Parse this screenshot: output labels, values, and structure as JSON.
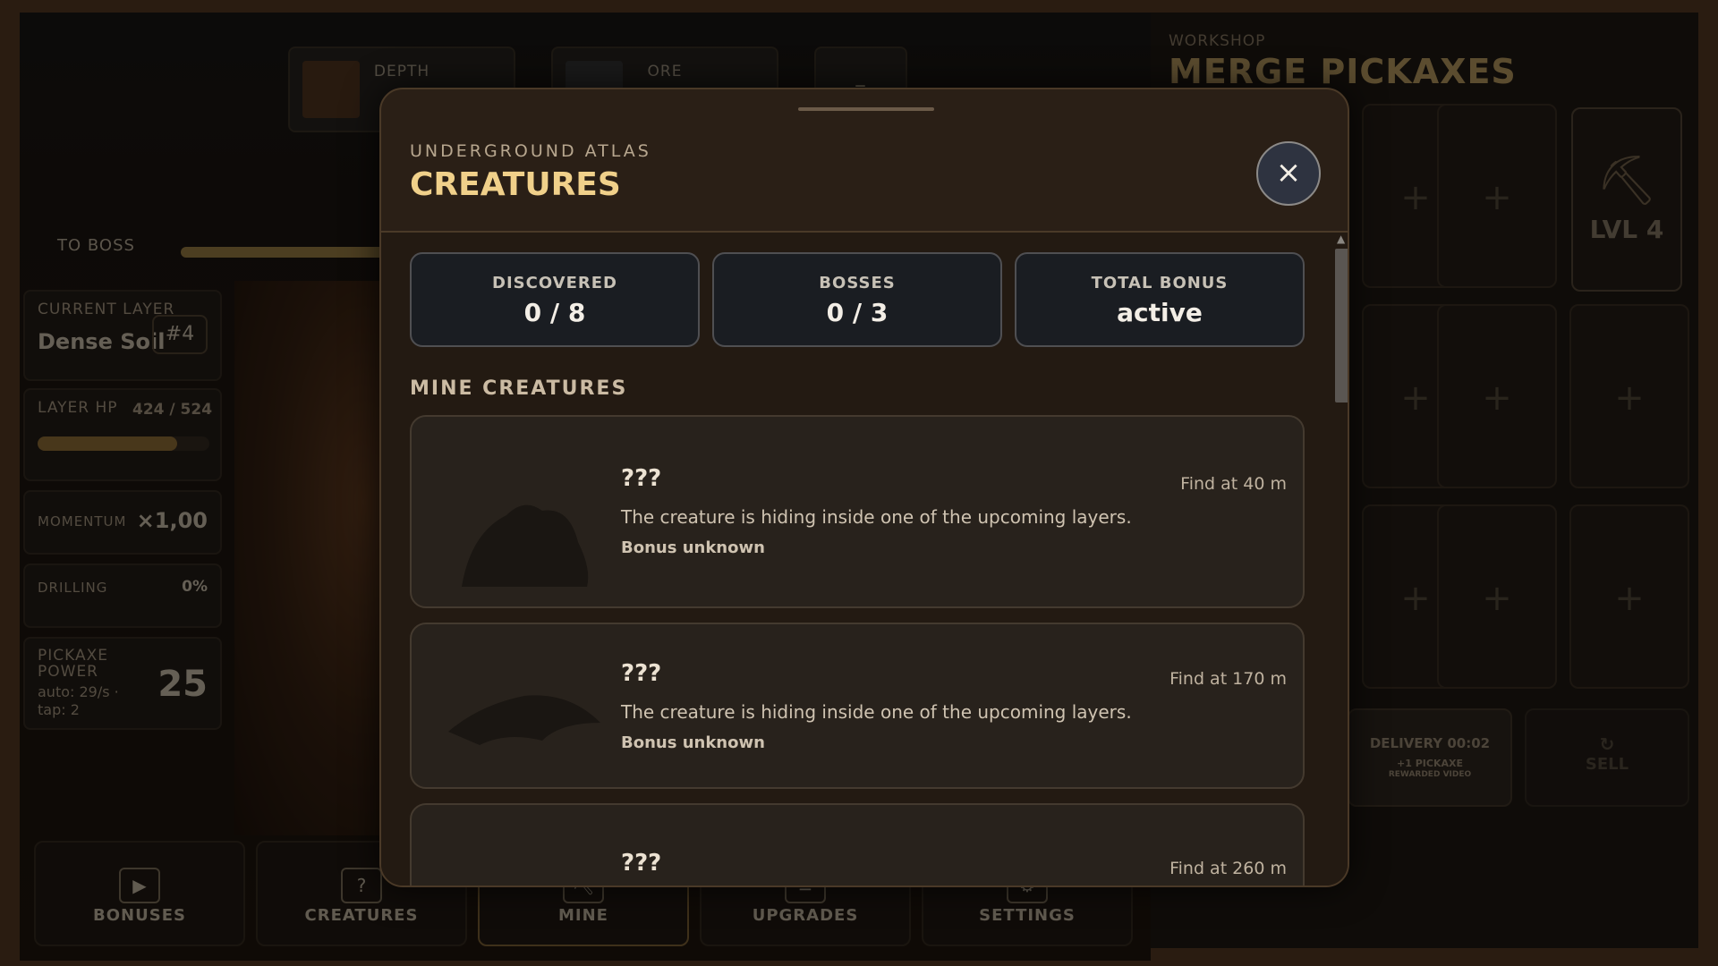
{
  "hud": {
    "depth_label": "DEPTH",
    "ore_label": "ORE",
    "small_label": "–",
    "to_boss_label": "TO BOSS",
    "boss_progress": 0.45
  },
  "stats_panel": {
    "current_layer_label": "CURRENT LAYER",
    "current_layer_value": "Dense Soil",
    "layer_number": "#4",
    "layer_hp_label": "LAYER HP",
    "layer_hp_value": "424 / 524",
    "layer_hp_fraction": 0.81,
    "momentum_label": "MOMENTUM",
    "momentum_value": "×1,00",
    "drilling_label": "DRILLING",
    "drilling_value": "0%",
    "pickaxe_power_label": "PICKAXE POWER",
    "pickaxe_power_sub": "auto: 29/s · tap: 2",
    "pickaxe_power_value": "25"
  },
  "bottom_nav": [
    {
      "label": "BONUSES",
      "icon": "▶"
    },
    {
      "label": "CREATURES",
      "icon": "?"
    },
    {
      "label": "MINE",
      "icon": "⛏"
    },
    {
      "label": "UPGRADES",
      "icon": "≡"
    },
    {
      "label": "SETTINGS",
      "icon": "⚙"
    }
  ],
  "workshop": {
    "subtitle": "WORKSHOP",
    "title": "MERGE PICKAXES",
    "slot_plus": "+",
    "filled_slot_level": "LVL 4",
    "delivery_label": "DELIVERY 00:02",
    "delivery_sub1": "+1 PICKAXE",
    "delivery_sub2": "REWARDED VIDEO",
    "sell_label": "SELL"
  },
  "modal": {
    "subtitle": "UNDERGROUND ATLAS",
    "title": "CREATURES",
    "close_icon": "×",
    "stats": [
      {
        "label": "DISCOVERED",
        "value": "0 / 8"
      },
      {
        "label": "BOSSES",
        "value": "0 / 3"
      },
      {
        "label": "TOTAL BONUS",
        "value": "active"
      }
    ],
    "section_title": "MINE CREATURES",
    "creatures": [
      {
        "name": "???",
        "description": "The creature is hiding inside one of the upcoming layers.",
        "bonus": "Bonus unknown",
        "find": "Find at 40 m"
      },
      {
        "name": "???",
        "description": "The creature is hiding inside one of the upcoming layers.",
        "bonus": "Bonus unknown",
        "find": "Find at 170 m"
      },
      {
        "name": "???",
        "find": "Find at 260 m"
      }
    ]
  }
}
